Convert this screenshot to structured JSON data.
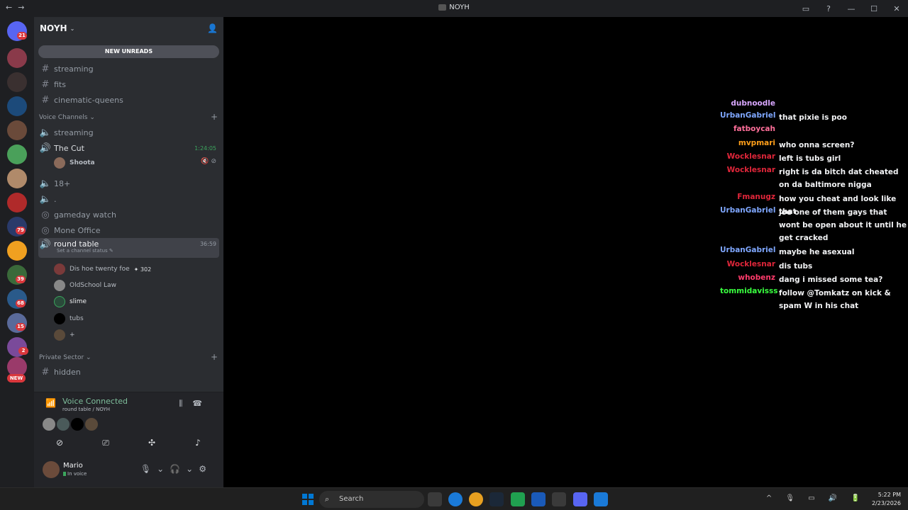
{
  "window": {
    "title": "NOYH"
  },
  "servers": {
    "badges": [
      "21",
      "79",
      "39",
      "68",
      "15",
      "2",
      "NEW"
    ]
  },
  "guild": {
    "name": "NOYH",
    "new_unreads": "NEW UNREADS"
  },
  "channels": {
    "text_top": [
      "streaming",
      "fits",
      "cinematic-queens"
    ],
    "voice_category": "Voice Channels",
    "voice": [
      {
        "name": "streaming"
      },
      {
        "name": "The Cut",
        "timer": "1:24:05"
      },
      {
        "name": "18+"
      },
      {
        "name": "."
      },
      {
        "name": "gameday watch"
      },
      {
        "name": "Mone Office"
      },
      {
        "name": "round table",
        "timer": "36:59",
        "status": "Set a channel status"
      }
    ],
    "the_cut_member": "Shoota",
    "round_table_members": [
      {
        "name": "Dis hoe twenty foe",
        "tag": "302"
      },
      {
        "name": "OldSchool Law"
      },
      {
        "name": "slime"
      },
      {
        "name": "tubs"
      },
      {
        "name": "+"
      }
    ],
    "private_category": "Private Sector",
    "private": [
      "hidden"
    ]
  },
  "voice_panel": {
    "title": "Voice Connected",
    "subtitle": "round table / NOYH"
  },
  "user": {
    "name": "Mario",
    "status": "In voice"
  },
  "chat": [
    {
      "user": "dubnoodle",
      "text": "",
      "color": "#d9a7ff"
    },
    {
      "user": "UrbanGabriel",
      "text": "that pixie is poo",
      "color": "#7fa7ff"
    },
    {
      "user": "fatboycah",
      "text": "",
      "color": "#ff6f9a"
    },
    {
      "user": "mvpmari",
      "text": "who onna screen?",
      "color": "#ff9f1a"
    },
    {
      "user": "Wocklesnar",
      "text": "left is tubs girl",
      "color": "#e0263a"
    },
    {
      "user": "Wocklesnar",
      "text": "right is da bitch dat cheated on da baltimore nigga",
      "color": "#e0263a"
    },
    {
      "user": "Fmanugz",
      "text": "how you cheat and look like that",
      "color": "#e0263a"
    },
    {
      "user": "UrbanGabriel",
      "text": "joe one of them gays that wont be open about it until he get cracked",
      "color": "#7fa7ff"
    },
    {
      "user": "UrbanGabriel",
      "text": "maybe he asexual",
      "color": "#7fa7ff"
    },
    {
      "user": "Wocklesnar",
      "text": "dis tubs",
      "color": "#e0263a"
    },
    {
      "user": "whobenz",
      "text": "dang i missed some tea?",
      "color": "#ff3b6b"
    },
    {
      "user": "tommidavisss",
      "text": "follow @Tomkatz on kick & spam W in his chat",
      "color": "#39ff3f"
    }
  ],
  "taskbar": {
    "search": "Search",
    "time": "5:22 PM",
    "date": "2/23/2026"
  }
}
